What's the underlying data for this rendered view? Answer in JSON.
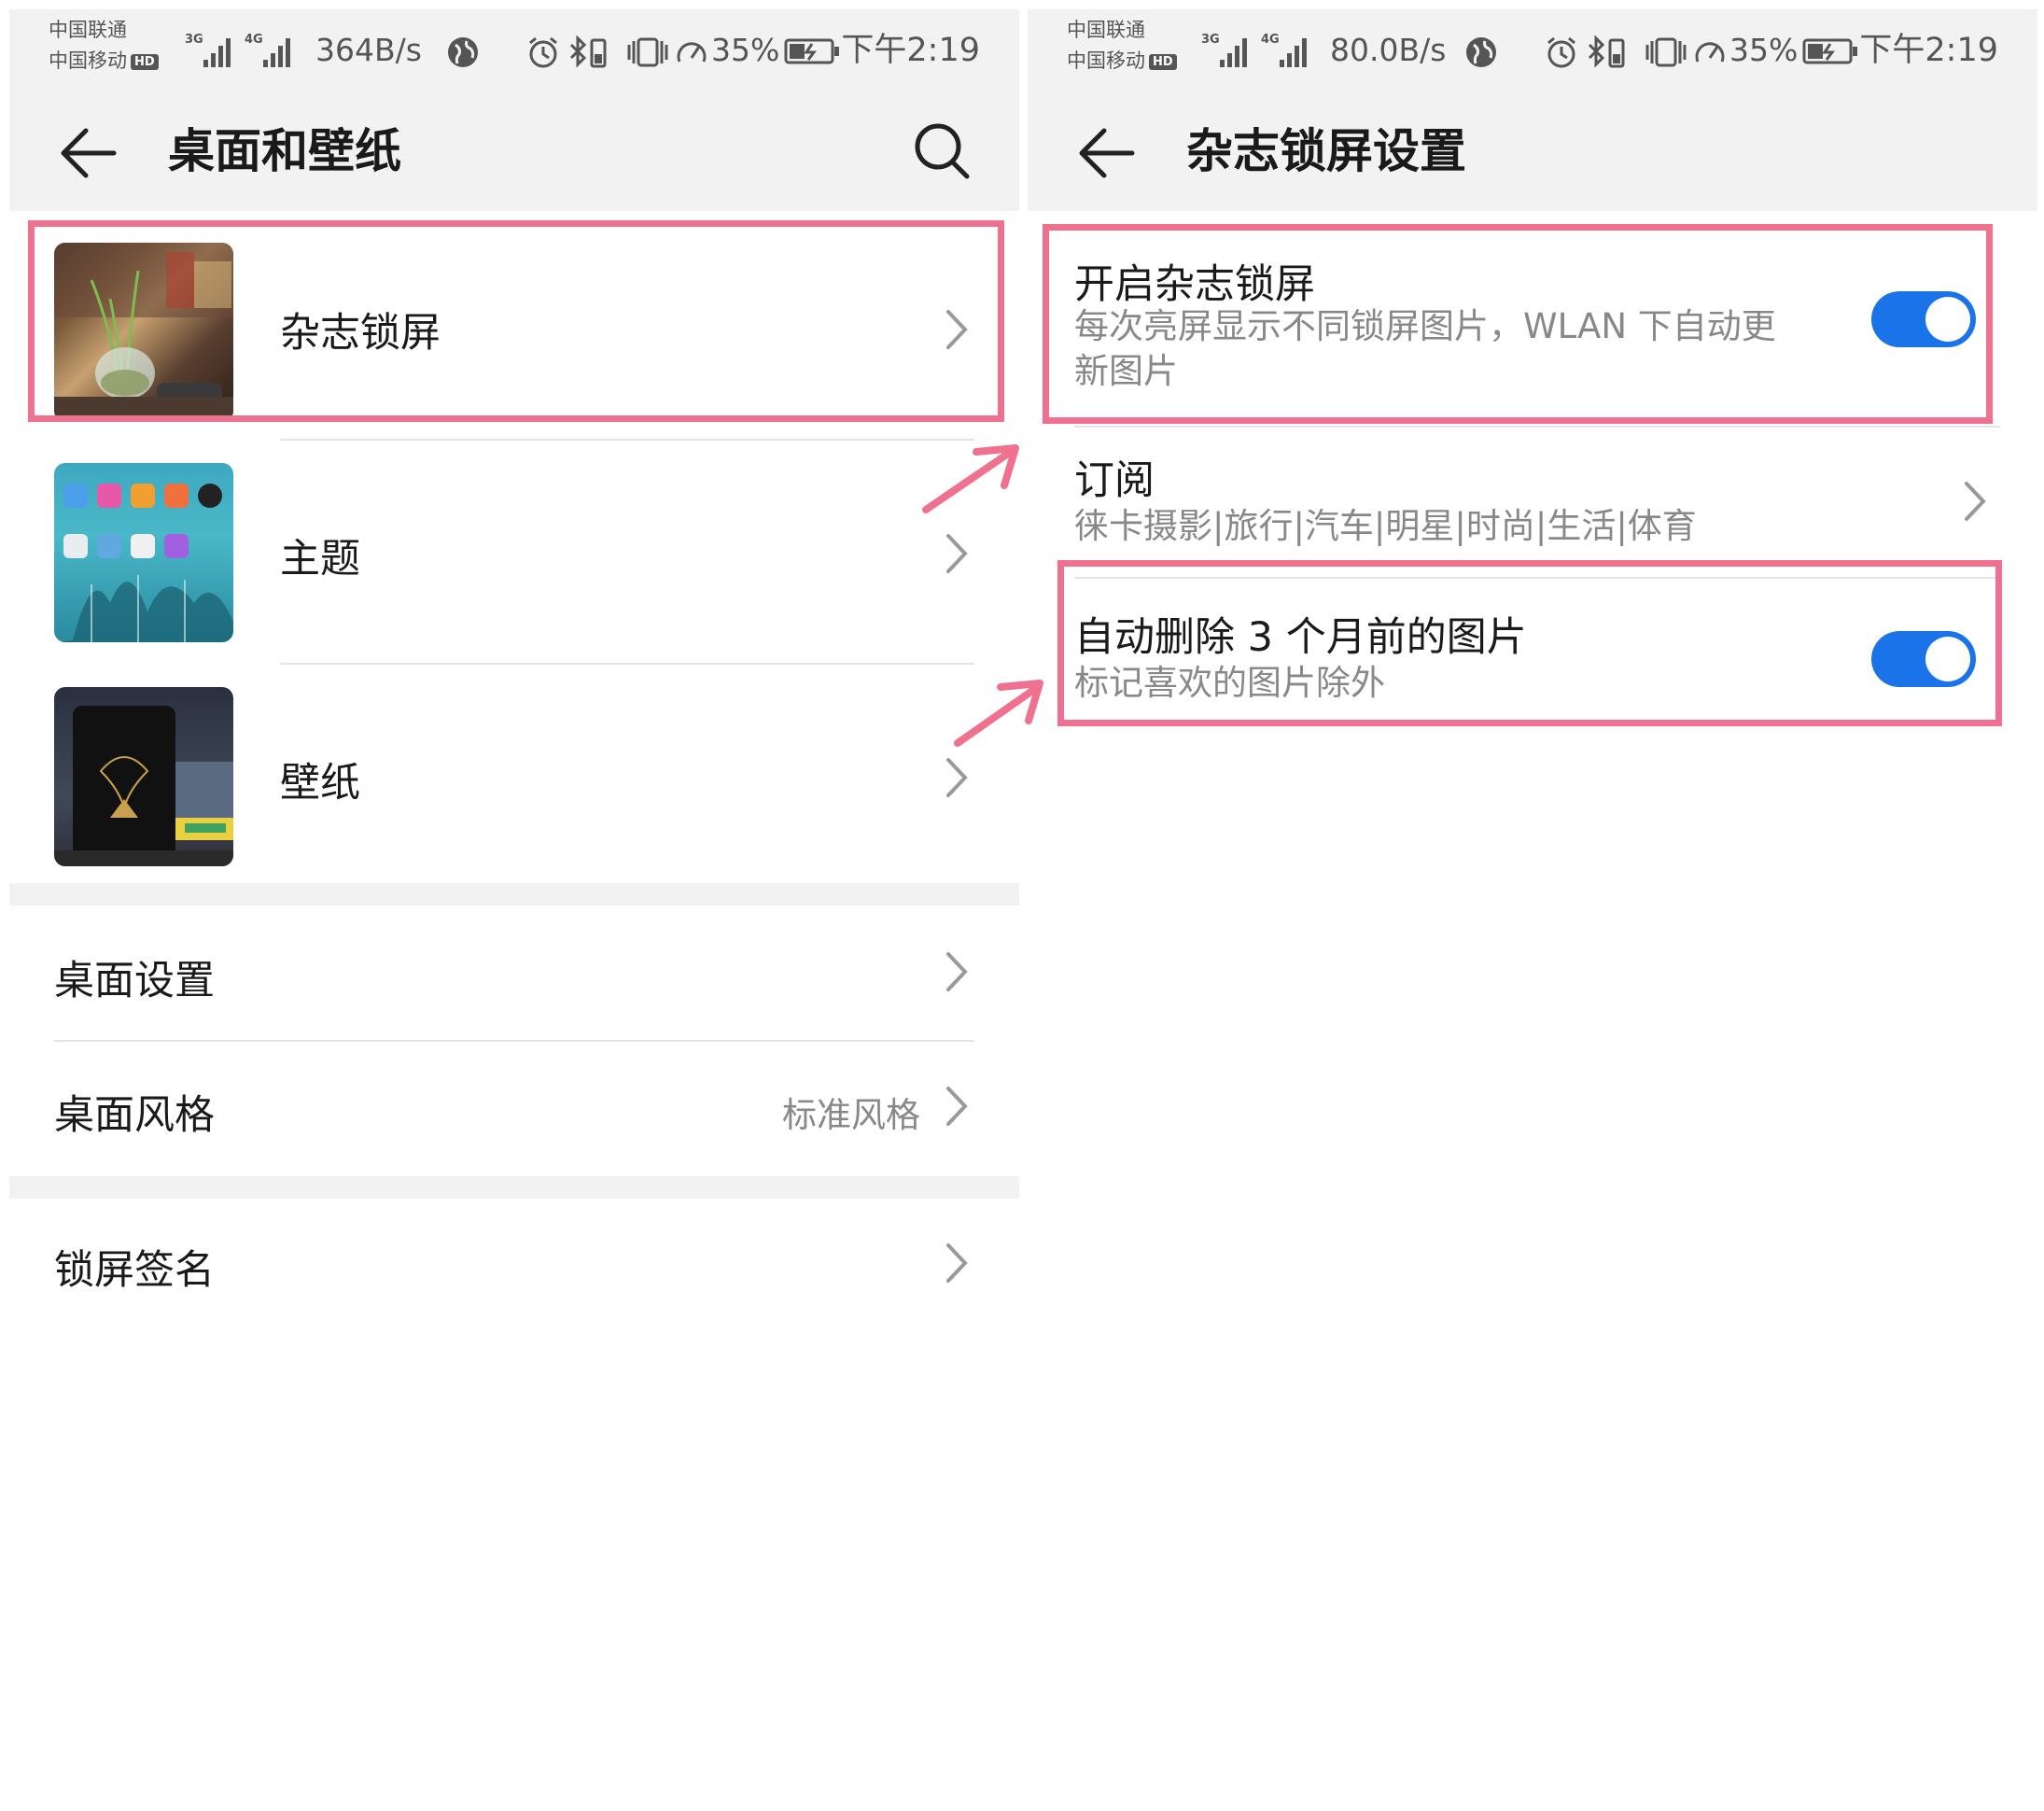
{
  "status_left": {
    "carrier_1": "中国联通",
    "carrier_2": "中国移动",
    "hd": "HD",
    "sig_3g": "3G",
    "sig_4g": "4G",
    "net_speed": "364B/s",
    "battery": "35%",
    "time": "下午2:19"
  },
  "status_right": {
    "carrier_1": "中国联通",
    "carrier_2": "中国移动",
    "hd": "HD",
    "sig_3g": "3G",
    "sig_4g": "4G",
    "net_speed": "80.0B/s",
    "battery": "35%",
    "time": "下午2:19"
  },
  "left_screen": {
    "title": "桌面和壁纸",
    "items": [
      {
        "label": "杂志锁屏",
        "thumbnail": "magazine-lockscreen-thumbnail"
      },
      {
        "label": "主题",
        "thumbnail": "theme-thumbnail"
      },
      {
        "label": "壁纸",
        "thumbnail": "wallpaper-thumbnail"
      }
    ],
    "desktop_settings": "桌面设置",
    "desktop_style": {
      "label": "桌面风格",
      "value": "标准风格"
    },
    "lockscreen_signature": "锁屏签名"
  },
  "right_screen": {
    "title": "杂志锁屏设置",
    "enable": {
      "title": "开启杂志锁屏",
      "subtitle_line1": "每次亮屏显示不同锁屏图片，WLAN 下自动更",
      "subtitle_line2": "新图片",
      "checked": true
    },
    "subscribe": {
      "title": "订阅",
      "subtitle": "徕卡摄影|旅行|汽车|明星|时尚|生活|体育"
    },
    "auto_delete": {
      "title": "自动删除 3 个月前的图片",
      "subtitle": "标记喜欢的图片除外",
      "checked": true
    }
  },
  "colors": {
    "highlight": "#f0708f",
    "toggle_on": "#1a73e8",
    "header_bg": "#f2f2f2"
  }
}
